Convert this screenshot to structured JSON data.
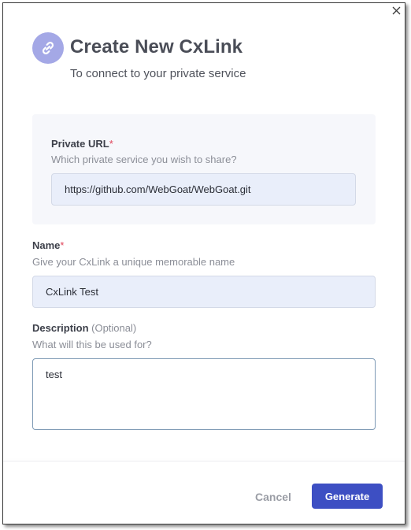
{
  "dialog": {
    "close_icon": "close-icon",
    "header_icon": "link-icon",
    "title": "Create New CxLink",
    "subtitle": "To connect to your private service"
  },
  "private_url": {
    "label": "Private URL",
    "required_mark": "*",
    "help": "Which private service you wish to share?",
    "value": "https://github.com/WebGoat/WebGoat.git"
  },
  "name": {
    "label": "Name",
    "required_mark": "*",
    "help": "Give your CxLink a unique memorable name",
    "value": "CxLink Test"
  },
  "description": {
    "label": "Description",
    "optional_mark": "(Optional)",
    "help": "What will this be used for?",
    "value": "test"
  },
  "footer": {
    "cancel_label": "Cancel",
    "generate_label": "Generate"
  },
  "colors": {
    "accent": "#3d4fc3",
    "icon_bg": "#a4a8e6",
    "required": "#e0455a",
    "input_bg": "#e9eefa",
    "panel_bg": "#f6f7fb"
  }
}
